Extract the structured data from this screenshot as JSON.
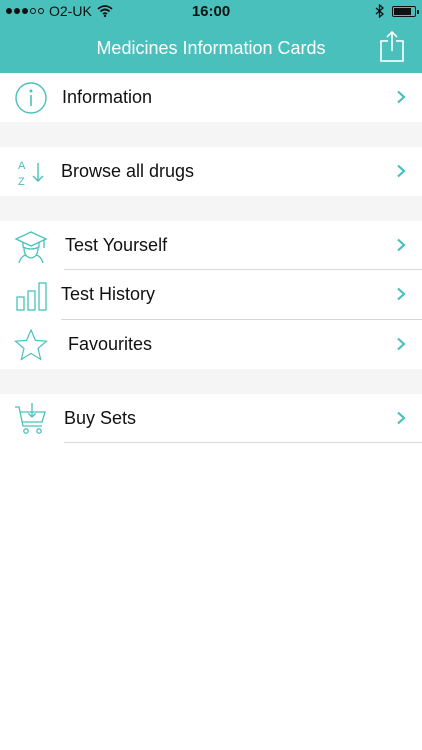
{
  "status_bar": {
    "carrier": "O2-UK",
    "time": "16:00"
  },
  "nav": {
    "title": "Medicines Information Cards",
    "share_icon": "share-icon"
  },
  "menu": {
    "information": {
      "label": "Information",
      "icon": "info-icon"
    },
    "browse": {
      "label": "Browse all drugs",
      "icon": "az-sort-icon"
    },
    "test_yourself": {
      "label": "Test Yourself",
      "icon": "graduate-icon"
    },
    "test_history": {
      "label": "Test History",
      "icon": "bar-chart-icon"
    },
    "favourites": {
      "label": "Favourites",
      "icon": "star-icon"
    },
    "buy_sets": {
      "label": "Buy Sets",
      "icon": "cart-icon"
    }
  },
  "colors": {
    "accent": "#4ac0bd",
    "separator": "#f5f5f5",
    "divider": "#d8d8d8"
  }
}
